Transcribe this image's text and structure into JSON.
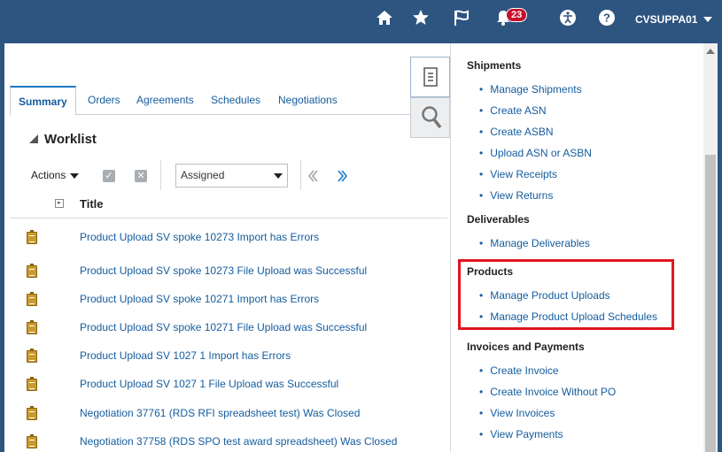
{
  "topbar": {
    "notification_count": "23",
    "user": "CVSUPPA01",
    "icons": [
      "home-icon",
      "star-icon",
      "flag-icon",
      "bell-icon",
      "accessibility-icon",
      "help-icon"
    ]
  },
  "tabs": [
    {
      "label": "Summary",
      "active": true
    },
    {
      "label": "Orders"
    },
    {
      "label": "Agreements"
    },
    {
      "label": "Schedules"
    },
    {
      "label": "Negotiations"
    }
  ],
  "worklist": {
    "title": "Worklist",
    "actions_label": "Actions",
    "filter_value": "Assigned",
    "column_title": "Title",
    "rows": [
      "Product Upload SV  spoke 10273 Import has Errors",
      "Product Upload SV  spoke 10273 File Upload was Successful",
      "Product Upload SV  spoke 10271 Import has Errors",
      "Product Upload SV  spoke 10271 File Upload was Successful",
      "Product Upload SV  1027 1 Import has Errors",
      "Product Upload SV  1027 1 File Upload was Successful",
      "Negotiation 37761 (RDS RFI spreadsheet test) Was Closed",
      "Negotiation 37758 (RDS SPO test award spreadsheet) Was Closed"
    ]
  },
  "panel": {
    "shipments": {
      "header": "Shipments",
      "items": [
        "Manage Shipments",
        "Create ASN",
        "Create ASBN",
        "Upload ASN or ASBN",
        "View Receipts",
        "View Returns"
      ]
    },
    "deliverables": {
      "header": "Deliverables",
      "items": [
        "Manage Deliverables"
      ]
    },
    "products": {
      "header": "Products",
      "items": [
        "Manage Product Uploads",
        "Manage Product Upload Schedules"
      ]
    },
    "invoices": {
      "header": "Invoices and Payments",
      "items": [
        "Create Invoice",
        "Create Invoice Without PO",
        "View Invoices",
        "View Payments"
      ]
    }
  },
  "colors": {
    "header_bg": "#2e5480",
    "link": "#145c9e",
    "highlight": "#e0161f",
    "badge": "#c8102e"
  }
}
